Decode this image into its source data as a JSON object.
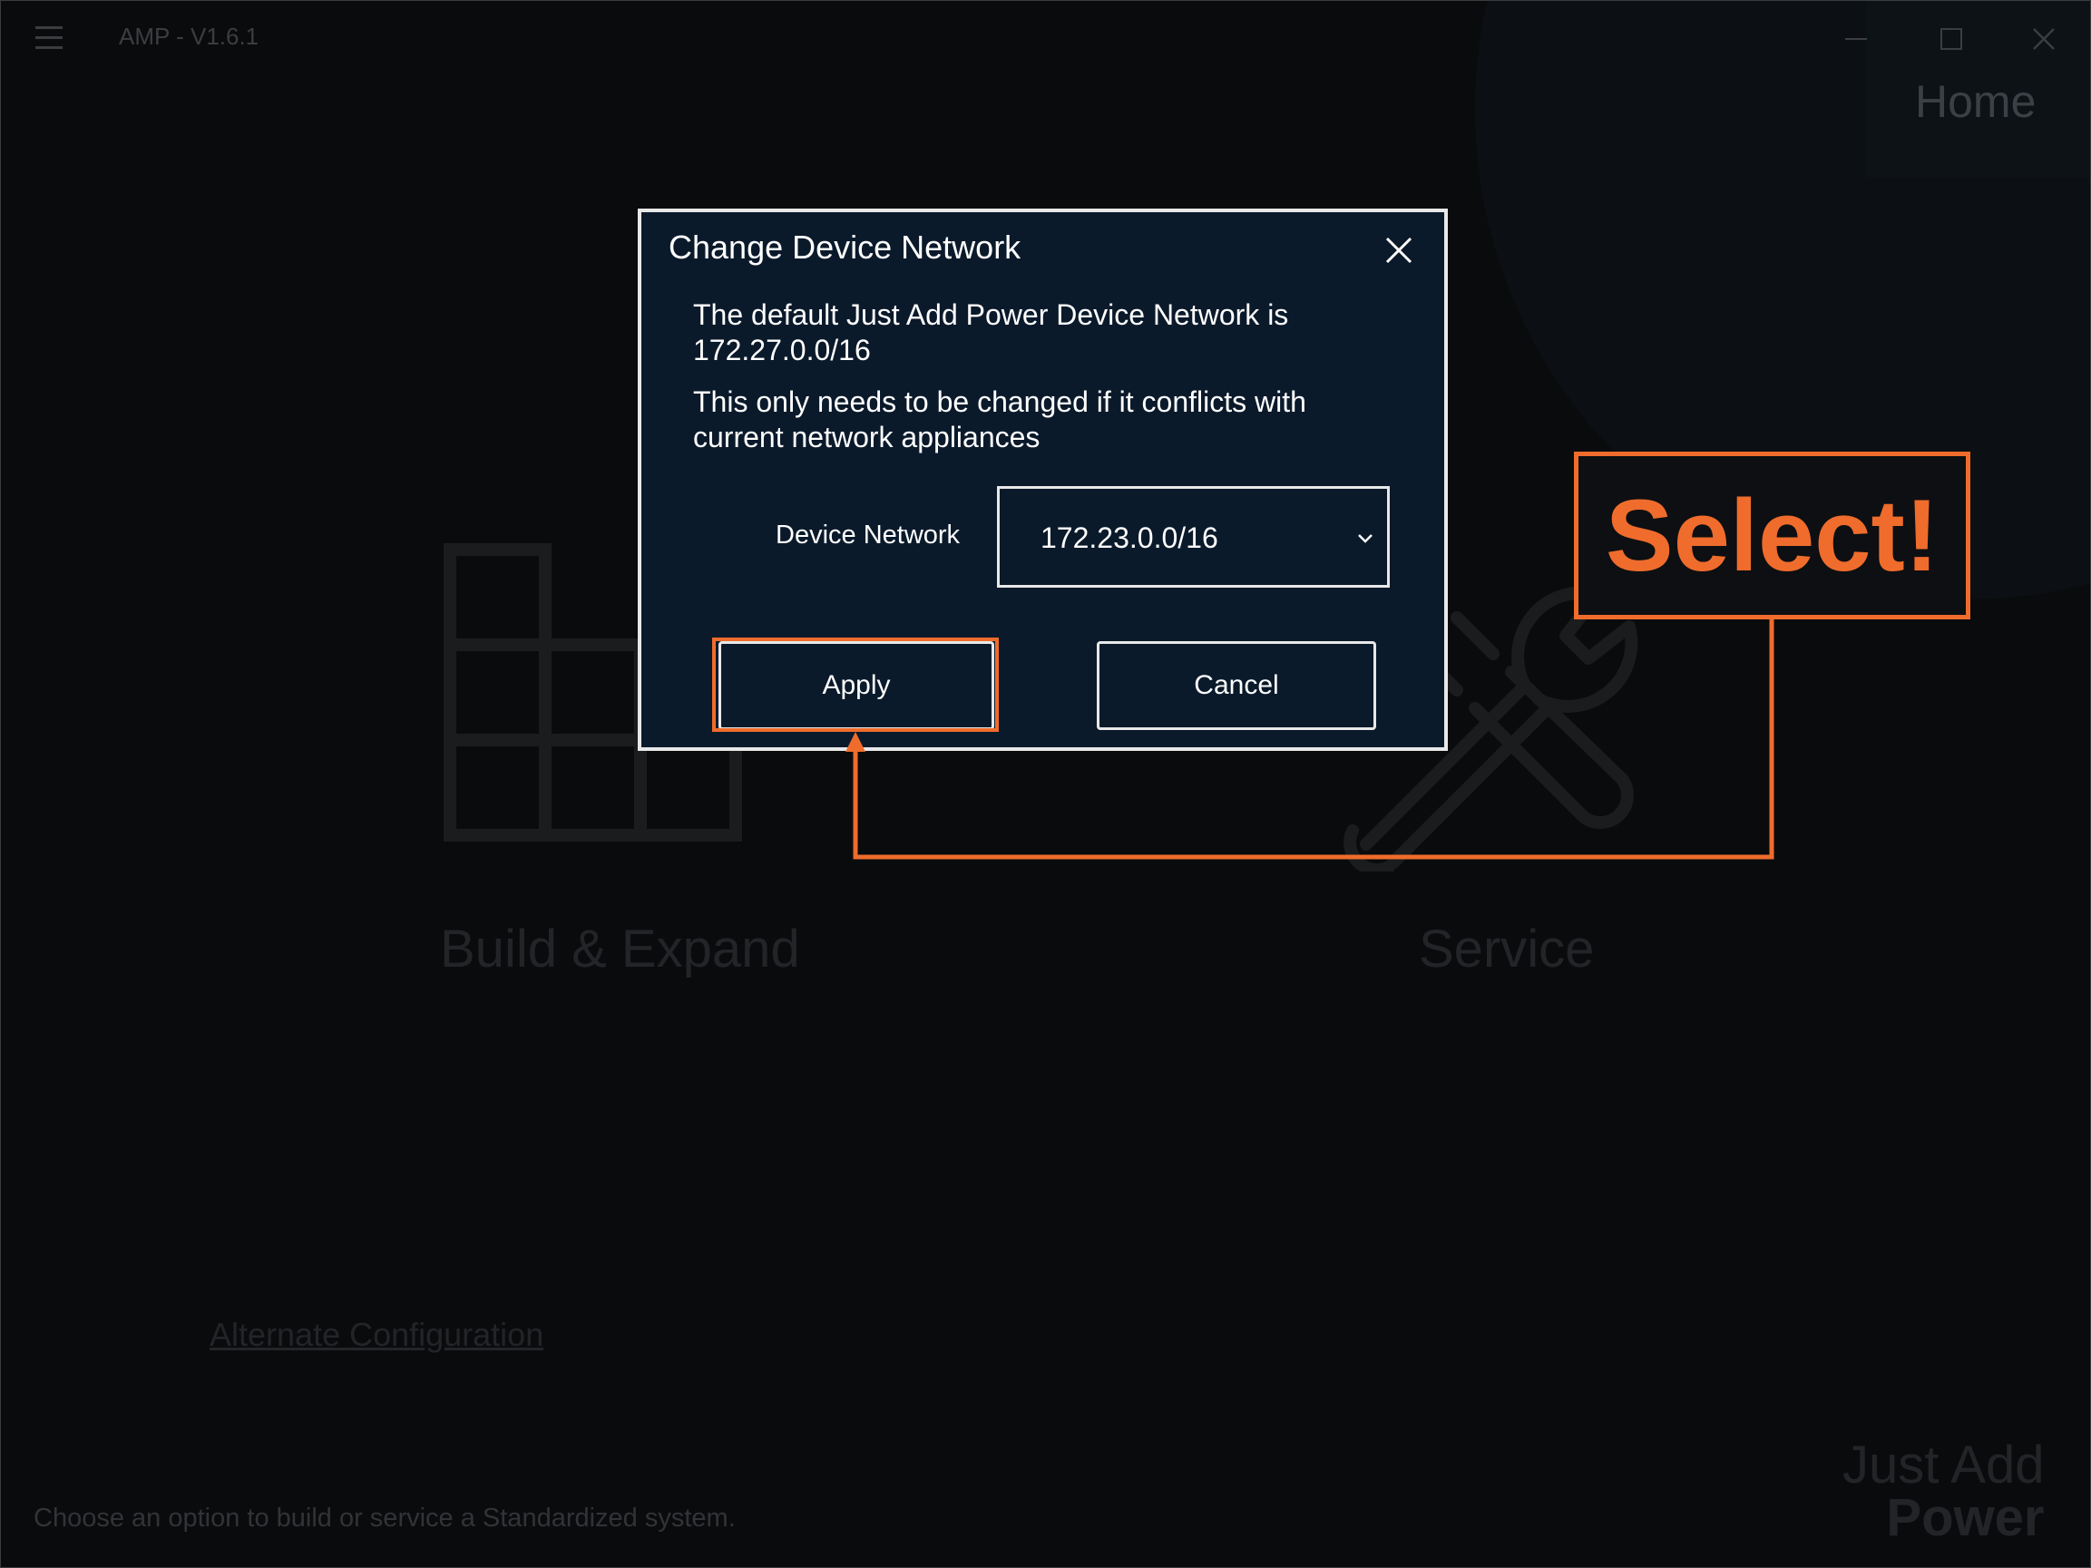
{
  "window": {
    "title": "AMP - V1.6.1"
  },
  "page": {
    "title": "Home"
  },
  "tiles": [
    {
      "label": "Build & Expand"
    },
    {
      "label": "Service"
    }
  ],
  "links": {
    "alternate": "Alternate Configuration"
  },
  "footer": {
    "hint": "Choose an option to build or service a Standardized system."
  },
  "brand": {
    "line1": "Just Add",
    "line2": "Power"
  },
  "dialog": {
    "title": "Change Device Network",
    "message1": "The default Just Add Power Device Network is 172.27.0.0/16",
    "message2": "This only needs to be changed if it conflicts with current network appliances",
    "field_label": "Device Network",
    "field_value": "172.23.0.0/16",
    "apply_label": "Apply",
    "cancel_label": "Cancel"
  },
  "callout": {
    "text": "Select!",
    "color": "#ef6c2c"
  },
  "icons": {
    "menu": "hamburger-menu-icon",
    "minimize": "minimize-icon",
    "maximize": "maximize-icon",
    "close": "close-icon",
    "build": "grid-blocks-icon",
    "service": "wrench-screwdriver-icon",
    "dropdown": "chevron-down-icon"
  }
}
